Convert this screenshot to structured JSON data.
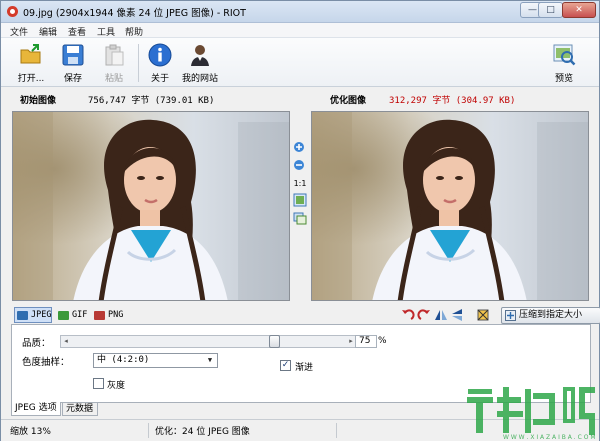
{
  "window": {
    "title": "09.jpg (2904x1944 像素 24 位 JPEG 图像) - RIOT",
    "minimize_glyph": "—",
    "maximize_glyph": "□",
    "close_glyph": "✕"
  },
  "menu": [
    "文件",
    "编辑",
    "查看",
    "工具",
    "帮助"
  ],
  "toolbar": {
    "open": "打开...",
    "save": "保存",
    "paste": "粘贴",
    "about": "关于",
    "website": "我的网站",
    "preview": "预览"
  },
  "info": {
    "original_label": "初始图像",
    "original_size": "756,747 字节 (739.01 KB)",
    "optimized_label": "优化图像",
    "optimized_size": "312,297 字节 (304.97 KB)"
  },
  "zoom": {
    "one_to_one": "1:1"
  },
  "formats": [
    "JPEG",
    "GIF",
    "PNG"
  ],
  "compress_button": "压缩到指定大小",
  "options": {
    "quality_label": "品质：",
    "quality_value": "75",
    "quality_percent": "%",
    "quality_level": 0.75,
    "chroma_label": "色度抽样：",
    "chroma_value": "中 (4:2:0)",
    "progressive_label": "渐进",
    "progressive_checked": true,
    "progressive_mark": "✓",
    "grayscale_label": "灰度",
    "grayscale_checked": false
  },
  "bottom_tabs": [
    "JPEG 选项",
    "元数据"
  ],
  "status": {
    "zoom": "缩放 13%",
    "optimized": "优化：24 位 JPEG 图像"
  },
  "colors": {
    "accent": "#cfe0f7",
    "optimized_size_color": "#c00000",
    "watermark": "#2fa84a"
  }
}
